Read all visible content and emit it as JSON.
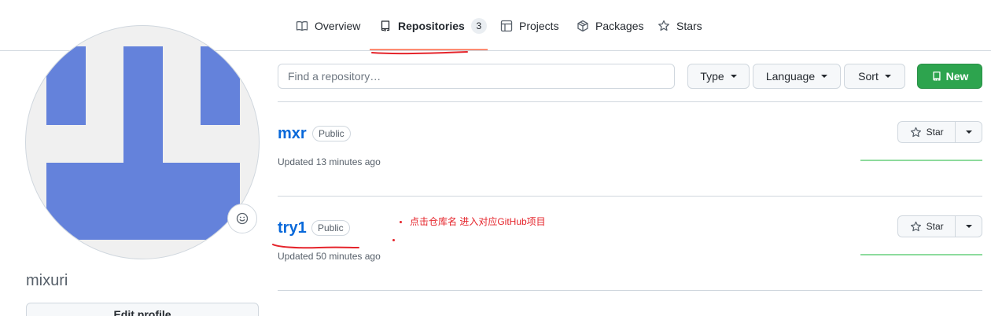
{
  "nav": {
    "tabs": [
      {
        "label": "Overview",
        "icon": "book-icon"
      },
      {
        "label": "Repositories",
        "icon": "repo-icon",
        "count": "3",
        "selected": true
      },
      {
        "label": "Projects",
        "icon": "table-icon"
      },
      {
        "label": "Packages",
        "icon": "package-icon"
      },
      {
        "label": "Stars",
        "icon": "star-icon"
      }
    ]
  },
  "profile": {
    "username": "mixuri",
    "edit_label": "Edit profile",
    "avatar_colors": {
      "background": "#f0f0f0",
      "blocks": "#6482db"
    }
  },
  "filters": {
    "search_placeholder": "Find a repository…",
    "type_label": "Type",
    "language_label": "Language",
    "sort_label": "Sort",
    "new_label": "New"
  },
  "repos": [
    {
      "name": "mxr",
      "visibility": "Public",
      "updated": "Updated 13 minutes ago",
      "star_label": "Star"
    },
    {
      "name": "try1",
      "visibility": "Public",
      "updated": "Updated 50 minutes ago",
      "star_label": "Star"
    }
  ],
  "annotation": {
    "text": "点击仓库名  进入对应GitHub项目",
    "color": "#e5242b"
  },
  "colors": {
    "link": "#0969da",
    "primary": "#2da44e",
    "tab_underline": "#fd8c73",
    "activity": "#8ddb9d"
  }
}
